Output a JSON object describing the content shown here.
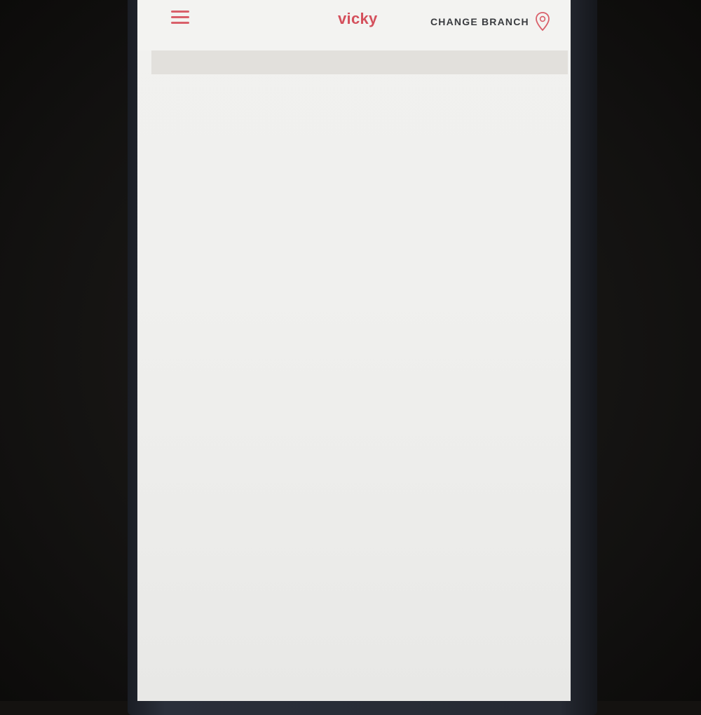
{
  "header": {
    "brand_name": "vicky",
    "change_branch_label": "CHANGE BRANCH"
  },
  "icons": {
    "menu": "hamburger-menu-icon",
    "location": "map-pin-icon"
  },
  "colors": {
    "accent": "#d4505c",
    "header_text": "#3a3c40",
    "screen_background": "#f0f0ee",
    "band": "#e2e0dc"
  }
}
